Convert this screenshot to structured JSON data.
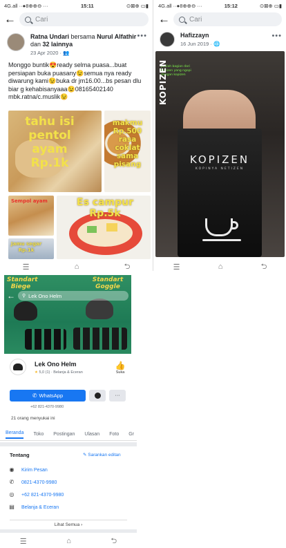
{
  "panel1": {
    "status": {
      "left": "4G.all ··●8⊕⊕⊖ ···",
      "time": "15:11",
      "right": "⊙⊠⊕ ▭▮"
    },
    "search": {
      "placeholder": "Cari"
    },
    "post": {
      "author": "Ratna Undari",
      "with_text": "bersama",
      "tagged": "Nurul Alfathir",
      "and_text": "dan",
      "others": "32 lainnya",
      "date": "23 Apr 2020 · 👥",
      "body": "Monggo buntik😍ready selma puasa...buat persiapan buka puasany😉semua nya ready diwarung kami😉buka dr jm16.00...bs pesan dlu biar g kehabisanyaaa😉08165402140 mbk.ratna/c.muslik😉",
      "photos": {
        "p1": [
          "tahu isi",
          "pentol",
          "ayam",
          "Rp.1k"
        ],
        "p2": [
          "makmu",
          "Rp.500",
          "rasa",
          "coklat",
          "sama",
          "pisang"
        ],
        "p3": "Sempol ayam",
        "p4": [
          "Es campur",
          "Rp.5k"
        ],
        "p5": [
          "Jamu segar",
          "Rp.1k"
        ]
      }
    }
  },
  "panel2": {
    "status": {
      "left": "4G.all ··●8⊕⊕⊖ ···",
      "time": "15:12",
      "right": "⊙⊠⊕ ▭▮"
    },
    "search": {
      "placeholder": "Cari"
    },
    "post": {
      "author": "Hafizzayn",
      "date": "16 Jun 2019 · 🌐",
      "caption_lines": [
        "Jadilah bagian dari",
        "Netizen yang ngopi",
        "dengan kopizen"
      ],
      "brand_vertical": "KOPIZEN",
      "brand": "KOPIZEN",
      "tagline": "KOPINYA NETIZEN"
    }
  },
  "panel3": {
    "cover": {
      "left_brand": "Standart Biege",
      "right_brand": "Standart Goggle"
    },
    "search": {
      "value": "Lek Ono Helm"
    },
    "page_name": "Lek Ono Helm",
    "rating": "5,0 (1) · Belanja & Eceran",
    "like_label": "Suka",
    "whatsapp_label": "WhatsApp",
    "phone_under_button": "+62 821-4370-9980",
    "likes_count": "21 orang menyukai ini",
    "tabs": [
      "Beranda",
      "Toko",
      "Postingan",
      "Ulasan",
      "Foto",
      "Gr"
    ],
    "about": {
      "title": "Tentang",
      "suggest_edit": "Sarankan editan",
      "rows": [
        {
          "icon": "messenger-icon",
          "text": "Kirim Pesan"
        },
        {
          "icon": "phone-icon",
          "text": "0821-4370-9980"
        },
        {
          "icon": "whatsapp-icon",
          "text": "+62 821-4370-9980"
        },
        {
          "icon": "store-icon",
          "text": "Belanja & Eceran"
        }
      ],
      "see_all": "Lihat Semua"
    }
  },
  "nav": {
    "menu": "☰",
    "home": "⌂",
    "back": "⮌"
  },
  "colors": {
    "fb_blue": "#1877f2",
    "whatsapp": "#25d366",
    "cover_green": "#1e8a5a"
  }
}
